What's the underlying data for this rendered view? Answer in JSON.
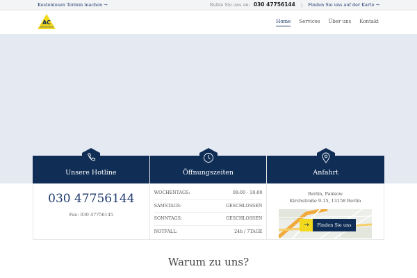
{
  "topbar": {
    "promo_link": "Kostenlosen Termin machen →",
    "call_label": "Rufen Sie uns an:",
    "phone": "030 47756144",
    "separator": "|",
    "map_link": "Finden Sie uns auf der Karte →"
  },
  "header": {
    "logo_text": "AC",
    "nav": [
      {
        "label": "Home",
        "active": true
      },
      {
        "label": "Services",
        "active": false
      },
      {
        "label": "Über uns",
        "active": false
      },
      {
        "label": "Kontakt",
        "active": false
      }
    ]
  },
  "hotline": {
    "title": "Unsere Hotline",
    "icon": "phone-icon",
    "phone": "030 47756144",
    "fax": "Fax: 030 47756145"
  },
  "hours": {
    "title": "Öffnungszeiten",
    "icon": "clock-icon",
    "rows": [
      {
        "day": "WOCHENTAGS:",
        "time": "08:00 - 18:00"
      },
      {
        "day": "SAMSTAGS:",
        "time": "GESCHLOSSEN"
      },
      {
        "day": "SONNTAGS:",
        "time": "GESCHLOSSEN"
      },
      {
        "day": "NOTFALL:",
        "time": "24h / 7TAGE"
      }
    ]
  },
  "directions": {
    "title": "Anfahrt",
    "icon": "map-pin-icon",
    "city": "Berlin, Pankow",
    "street": "Kirchstraße 9-15, 13158 Berlin",
    "button_label": "Finden Sie uns"
  },
  "section_title": "Warum zu uns?",
  "colors": {
    "navy": "#0f2d55",
    "accent_yellow": "#f3d91e",
    "hero_bg": "#e4e9f2",
    "link_blue": "#1f3a6e"
  }
}
